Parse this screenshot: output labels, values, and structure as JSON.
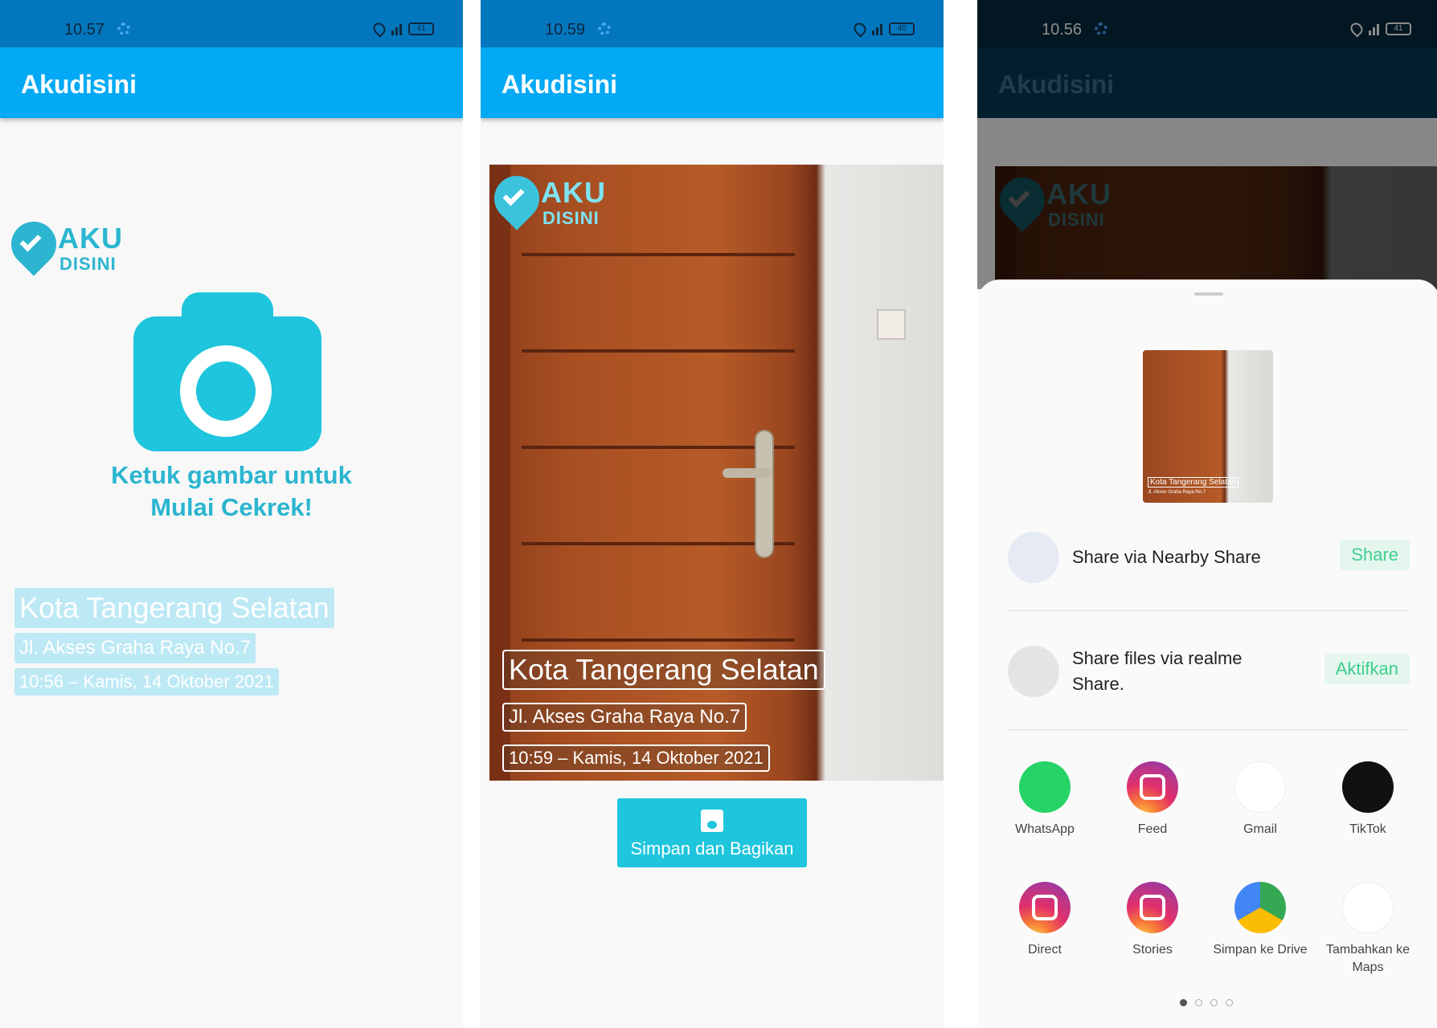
{
  "screen1": {
    "status": {
      "time": "10.57",
      "battery": "41"
    },
    "app_title": "Akudisini",
    "logo": {
      "line1": "AKU",
      "line2": "DISINI"
    },
    "tap_text": {
      "line1": "Ketuk gambar untuk",
      "line2": "Mulai Cekrek!"
    },
    "overlay": {
      "city": "Kota Tangerang Selatan",
      "street": "Jl. Akses Graha Raya No.7",
      "datetime": "10:56 – Kamis, 14 Oktober 2021"
    }
  },
  "screen2": {
    "status": {
      "time": "10.59",
      "battery": "40"
    },
    "app_title": "Akudisini",
    "logo": {
      "line1": "AKU",
      "line2": "DISINI"
    },
    "caption": {
      "city": "Kota Tangerang Selatan",
      "street": "Jl. Akses Graha Raya No.7",
      "datetime": "10:59 – Kamis, 14 Oktober 2021"
    },
    "save_button_label": "Simpan dan Bagikan"
  },
  "screen3": {
    "status": {
      "time": "10.56",
      "battery": "41"
    },
    "app_title": "Akudisini",
    "logo": {
      "line1": "AKU",
      "line2": "DISINI"
    },
    "thumb_caption": "Kota Tangerang Selatan",
    "thumb_caption2": "Jl. Akses Graha Raya No.7",
    "nearby": {
      "label": "Share via Nearby Share",
      "action": "Share"
    },
    "realme": {
      "line1": "Share files via realme",
      "line2": "Share.",
      "action": "Aktifkan"
    },
    "apps": [
      {
        "name": "WhatsApp",
        "icon": "whatsapp-icon"
      },
      {
        "name": "Feed",
        "icon": "instagram-icon"
      },
      {
        "name": "Gmail",
        "icon": "gmail-icon"
      },
      {
        "name": "TikTok",
        "icon": "tiktok-icon"
      },
      {
        "name": "Direct",
        "icon": "instagram-icon"
      },
      {
        "name": "Stories",
        "icon": "instagram-icon"
      },
      {
        "name": "Simpan ke Drive",
        "icon": "drive-icon"
      },
      {
        "name": "Tambahkan ke Maps",
        "icon": "maps-icon"
      }
    ],
    "page_indicator": {
      "pages": 4,
      "current": 1
    }
  },
  "colors": {
    "appbar": "#03a9f4",
    "statusbar": "#0277bd",
    "accent": "#1ec5dc",
    "share_action": "#3ecf8e"
  }
}
